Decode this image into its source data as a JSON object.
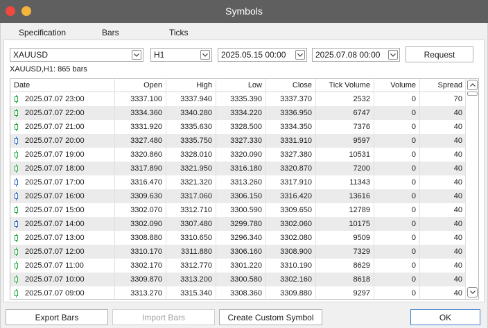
{
  "window": {
    "title": "Symbols"
  },
  "tabs": [
    {
      "label": "Specification",
      "active": false
    },
    {
      "label": "Bars",
      "active": true
    },
    {
      "label": "Ticks",
      "active": false
    }
  ],
  "filters": {
    "symbol": "XAUUSD",
    "timeframe": "H1",
    "date_from": "2025.05.15 00:00",
    "date_to": "2025.07.08 00:00",
    "request_label": "Request"
  },
  "info_text": "XAUUSD,H1: 865 bars",
  "table": {
    "columns": [
      "Date",
      "Open",
      "High",
      "Low",
      "Close",
      "Tick Volume",
      "Volume",
      "Spread"
    ],
    "rows": [
      {
        "dir": "bull",
        "date": "2025.07.07 23:00",
        "open": "3337.100",
        "high": "3337.940",
        "low": "3335.390",
        "close": "3337.370",
        "tick_volume": "2532",
        "volume": "0",
        "spread": "70"
      },
      {
        "dir": "bull",
        "date": "2025.07.07 22:00",
        "open": "3334.360",
        "high": "3340.280",
        "low": "3334.220",
        "close": "3336.950",
        "tick_volume": "6747",
        "volume": "0",
        "spread": "40"
      },
      {
        "dir": "bull",
        "date": "2025.07.07 21:00",
        "open": "3331.920",
        "high": "3335.630",
        "low": "3328.500",
        "close": "3334.350",
        "tick_volume": "7376",
        "volume": "0",
        "spread": "40"
      },
      {
        "dir": "bear",
        "date": "2025.07.07 20:00",
        "open": "3327.480",
        "high": "3335.750",
        "low": "3327.330",
        "close": "3331.910",
        "tick_volume": "9597",
        "volume": "0",
        "spread": "40"
      },
      {
        "dir": "bull",
        "date": "2025.07.07 19:00",
        "open": "3320.860",
        "high": "3328.010",
        "low": "3320.090",
        "close": "3327.380",
        "tick_volume": "10531",
        "volume": "0",
        "spread": "40"
      },
      {
        "dir": "bull",
        "date": "2025.07.07 18:00",
        "open": "3317.890",
        "high": "3321.950",
        "low": "3316.180",
        "close": "3320.870",
        "tick_volume": "7200",
        "volume": "0",
        "spread": "40"
      },
      {
        "dir": "bear",
        "date": "2025.07.07 17:00",
        "open": "3316.470",
        "high": "3321.320",
        "low": "3313.260",
        "close": "3317.910",
        "tick_volume": "11343",
        "volume": "0",
        "spread": "40"
      },
      {
        "dir": "bear",
        "date": "2025.07.07 16:00",
        "open": "3309.630",
        "high": "3317.060",
        "low": "3306.150",
        "close": "3316.420",
        "tick_volume": "13616",
        "volume": "0",
        "spread": "40"
      },
      {
        "dir": "bull",
        "date": "2025.07.07 15:00",
        "open": "3302.070",
        "high": "3312.710",
        "low": "3300.590",
        "close": "3309.650",
        "tick_volume": "12789",
        "volume": "0",
        "spread": "40"
      },
      {
        "dir": "bear",
        "date": "2025.07.07 14:00",
        "open": "3302.090",
        "high": "3307.480",
        "low": "3299.780",
        "close": "3302.060",
        "tick_volume": "10175",
        "volume": "0",
        "spread": "40"
      },
      {
        "dir": "bull",
        "date": "2025.07.07 13:00",
        "open": "3308.880",
        "high": "3310.650",
        "low": "3296.340",
        "close": "3302.080",
        "tick_volume": "9509",
        "volume": "0",
        "spread": "40"
      },
      {
        "dir": "bull",
        "date": "2025.07.07 12:00",
        "open": "3310.170",
        "high": "3311.880",
        "low": "3306.160",
        "close": "3308.900",
        "tick_volume": "7329",
        "volume": "0",
        "spread": "40"
      },
      {
        "dir": "bull",
        "date": "2025.07.07 11:00",
        "open": "3302.170",
        "high": "3312.770",
        "low": "3301.220",
        "close": "3310.190",
        "tick_volume": "8629",
        "volume": "0",
        "spread": "40"
      },
      {
        "dir": "bull",
        "date": "2025.07.07 10:00",
        "open": "3309.870",
        "high": "3313.200",
        "low": "3300.580",
        "close": "3302.160",
        "tick_volume": "8618",
        "volume": "0",
        "spread": "40"
      },
      {
        "dir": "bull",
        "date": "2025.07.07 09:00",
        "open": "3313.270",
        "high": "3315.340",
        "low": "3308.360",
        "close": "3309.880",
        "tick_volume": "9297",
        "volume": "0",
        "spread": "40"
      }
    ]
  },
  "footer": {
    "export_label": "Export Bars",
    "import_label": "Import Bars",
    "create_label": "Create Custom Symbol",
    "ok_label": "OK"
  },
  "colors": {
    "bull": "#1eaa3a",
    "bear": "#2a64c8",
    "accent": "#3d7ed0"
  }
}
